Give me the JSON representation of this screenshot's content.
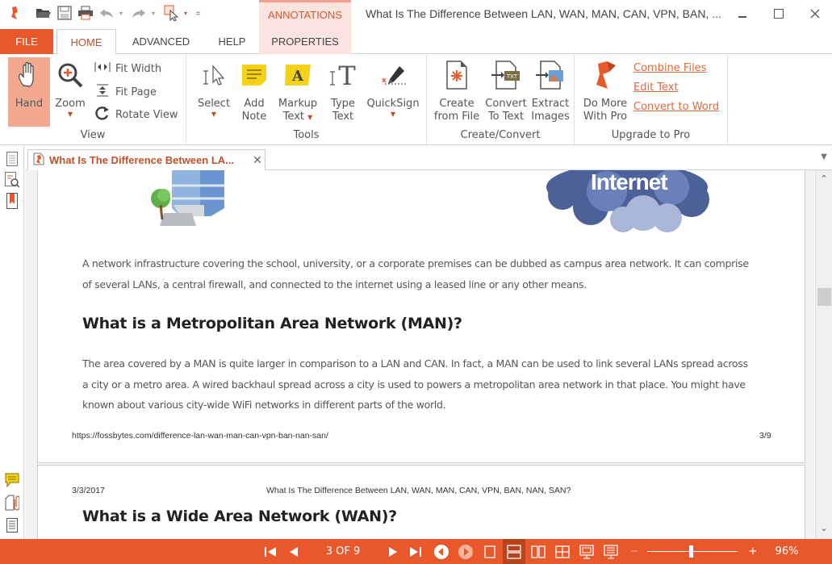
{
  "app": {
    "window_title": "What Is The Difference Between LAN, WAN, MAN, CAN, VPN, BAN, ...",
    "context_tab_group": "ANNOTATIONS",
    "brand_color": "#e8582a",
    "quick_access": [
      "app-logo-icon",
      "open-folder-icon",
      "save-icon",
      "print-icon",
      "undo-icon",
      "redo-icon",
      "select-tool-icon",
      "customize-icon"
    ]
  },
  "tabs": [
    {
      "label": "FILE"
    },
    {
      "label": "HOME"
    },
    {
      "label": "ADVANCED"
    },
    {
      "label": "HELP"
    },
    {
      "label": "PROPERTIES"
    }
  ],
  "ribbon": {
    "view": {
      "label": "View",
      "hand": "Hand",
      "zoom": "Zoom",
      "fit_width": "Fit Width",
      "fit_page": "Fit Page",
      "rotate_view": "Rotate View"
    },
    "tools": {
      "label": "Tools",
      "select": "Select",
      "add_note_1": "Add",
      "add_note_2": "Note",
      "markup_1": "Markup",
      "markup_2": "Text",
      "type_1": "Type",
      "type_2": "Text",
      "quicksign": "QuickSign"
    },
    "create": {
      "label": "Create/Convert",
      "create_1": "Create",
      "create_2": "from File",
      "convert_1": "Convert",
      "convert_2": "To Text",
      "extract_1": "Extract",
      "extract_2": "Images"
    },
    "upgrade": {
      "label": "Upgrade to Pro",
      "do_more_1": "Do More",
      "do_more_2": "With Pro",
      "links": [
        "Combine Files",
        "Edit Text",
        "Convert to Word"
      ]
    }
  },
  "document_tab": {
    "title": "What Is The Difference Between LA..."
  },
  "document": {
    "page1": {
      "image_label": "Internet",
      "paragraph1_lines": [
        "A network infrastructure covering the school, university, or a corporate premises can be dubbed as campus area network. It can comprise",
        "of several LANs, a central firewall, and connected to the internet using a leased line or any other means."
      ],
      "heading": "What is a Metropolitan Area Network (MAN)?",
      "paragraph2_lines": [
        "The area covered by a MAN is quite larger in comparison to a LAN and CAN. In fact, a MAN can be used to link several LANs spread across",
        "a city or a metro area. A wired backhaul spread across a city is used to powers a metropolitan area network in that place. You might have",
        "known about various city-wide WiFi networks in different parts of the world."
      ],
      "footer_url": "https://fossbytes.com/difference-lan-wan-man-can-vpn-ban-nan-san/",
      "footer_page": "3/9"
    },
    "page2": {
      "header_date": "3/3/2017",
      "header_title": "What Is The Difference Between LAN, WAN, MAN, CAN, VPN, BAN, NAN, SAN?",
      "heading": "What is a Wide Area Network (WAN)?"
    }
  },
  "statusbar": {
    "page_indicator": "3 OF 9",
    "current_page": 3,
    "total_pages": 9,
    "zoom_minus": "−",
    "zoom_plus": "+",
    "zoom_label": "96%",
    "zoom_percent": 96
  },
  "scrollbar": {
    "position_fraction": 0.32
  }
}
